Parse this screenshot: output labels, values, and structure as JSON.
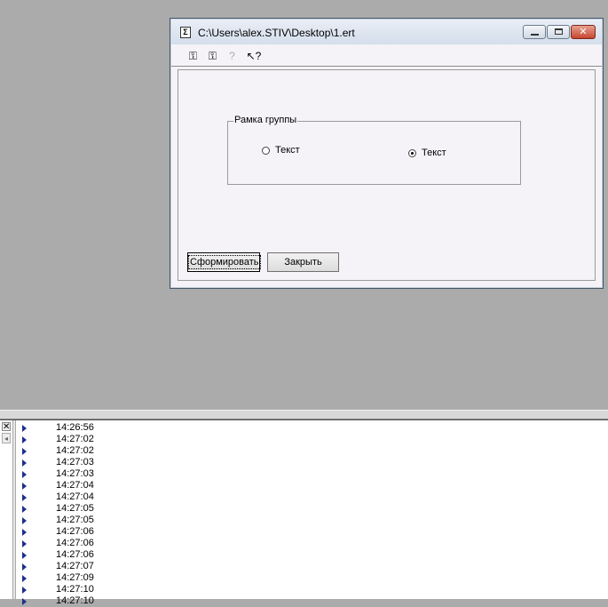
{
  "window": {
    "title": "C:\\Users\\alex.STIV\\Desktop\\1.ert",
    "title_icon": "Σ"
  },
  "toolbar": {
    "tools": [
      {
        "name": "ruler-lock-icon",
        "glyph": "⚿"
      },
      {
        "name": "ruler-lock-alt-icon",
        "glyph": "⚿"
      },
      {
        "name": "help-page-icon",
        "glyph": "?"
      },
      {
        "name": "pointer-help-icon",
        "glyph": "↖?"
      }
    ]
  },
  "form": {
    "group_label": "Рамка группы",
    "radio1": {
      "label": "Текст",
      "checked": false
    },
    "radio2": {
      "label": "Текст",
      "checked": true
    },
    "generate_button": "Сформировать",
    "close_button": "Закрыть"
  },
  "log": {
    "close_glyph": "✕",
    "scroll_glyph": "◂",
    "times": [
      "14:26:56",
      "14:27:02",
      "14:27:02",
      "14:27:03",
      "14:27:03",
      "14:27:04",
      "14:27:04",
      "14:27:05",
      "14:27:05",
      "14:27:06",
      "14:27:06",
      "14:27:06",
      "14:27:07",
      "14:27:09",
      "14:27:10",
      "14:27:10"
    ]
  },
  "colors": {
    "desktop": "#ababab",
    "window_bg": "#f5f3f7",
    "log_arrow": "#1e2f8c",
    "close_button": "#c7452f"
  }
}
